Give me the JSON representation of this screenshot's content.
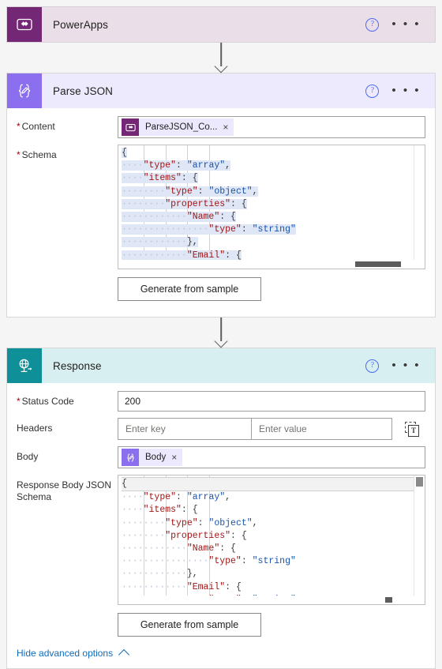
{
  "cards": {
    "powerapps": {
      "title": "PowerApps",
      "icon": "powerapps-icon",
      "help": "?",
      "menu": "• • •",
      "header_color": "#eadfe9",
      "icon_color": "#742774"
    },
    "parse_json": {
      "title": "Parse JSON",
      "icon": "parse-json-braces-icon",
      "help": "?",
      "menu": "• • •",
      "header_color": "#eeeafd",
      "icon_color": "#8c6fef",
      "fields": {
        "content": {
          "label": "Content",
          "required": true,
          "token": {
            "text": "ParseJSON_Co...",
            "remove": "×",
            "icon": "powerapps-icon"
          }
        },
        "schema": {
          "label": "Schema",
          "required": true
        }
      },
      "generate_button": "Generate from sample"
    },
    "response": {
      "title": "Response",
      "icon": "response-globe-icon",
      "help": "?",
      "menu": "• • •",
      "header_color": "#d7eff0",
      "icon_color": "#0f9099",
      "fields": {
        "status_code": {
          "label": "Status Code",
          "required": true,
          "value": "200"
        },
        "headers": {
          "label": "Headers",
          "required": false,
          "key_placeholder": "Enter key",
          "value_placeholder": "Enter value",
          "key_value": "",
          "value_value": "",
          "switch_icon": "switch-to-text-mode-icon",
          "switch_icon_letter": "T"
        },
        "body": {
          "label": "Body",
          "required": false,
          "token": {
            "text": "Body",
            "remove": "×",
            "icon": "parse-json-braces-icon"
          }
        },
        "response_schema": {
          "label": "Response Body JSON Schema",
          "required": false
        }
      },
      "generate_button": "Generate from sample"
    }
  },
  "advanced_options": {
    "label": "Hide advanced options",
    "chevron": "chevron-up-icon"
  },
  "schema_code": {
    "selected": true,
    "lines": [
      [
        {
          "t": "{",
          "c": "pun"
        }
      ],
      [
        {
          "t": "    ",
          "c": "ws"
        },
        {
          "t": "\"type\"",
          "c": "key"
        },
        {
          "t": ": ",
          "c": "pun"
        },
        {
          "t": "\"array\"",
          "c": "str"
        },
        {
          "t": ",",
          "c": "pun"
        }
      ],
      [
        {
          "t": "    ",
          "c": "ws"
        },
        {
          "t": "\"items\"",
          "c": "key"
        },
        {
          "t": ": {",
          "c": "pun"
        }
      ],
      [
        {
          "t": "        ",
          "c": "ws"
        },
        {
          "t": "\"type\"",
          "c": "key"
        },
        {
          "t": ": ",
          "c": "pun"
        },
        {
          "t": "\"object\"",
          "c": "str"
        },
        {
          "t": ",",
          "c": "pun"
        }
      ],
      [
        {
          "t": "        ",
          "c": "ws"
        },
        {
          "t": "\"properties\"",
          "c": "key"
        },
        {
          "t": ": {",
          "c": "pun"
        }
      ],
      [
        {
          "t": "            ",
          "c": "ws"
        },
        {
          "t": "\"Name\"",
          "c": "key"
        },
        {
          "t": ": {",
          "c": "pun"
        }
      ],
      [
        {
          "t": "                ",
          "c": "ws"
        },
        {
          "t": "\"type\"",
          "c": "key"
        },
        {
          "t": ": ",
          "c": "pun"
        },
        {
          "t": "\"string\"",
          "c": "str"
        }
      ],
      [
        {
          "t": "            ",
          "c": "ws"
        },
        {
          "t": "},",
          "c": "pun"
        }
      ],
      [
        {
          "t": "            ",
          "c": "ws"
        },
        {
          "t": "\"Email\"",
          "c": "key"
        },
        {
          "t": ": {",
          "c": "pun"
        }
      ],
      [
        {
          "t": "                ",
          "c": "ws"
        },
        {
          "t": "\"type\"",
          "c": "key"
        },
        {
          "t": ": ",
          "c": "pun"
        },
        {
          "t": "\"string\"",
          "c": "str"
        }
      ]
    ]
  }
}
